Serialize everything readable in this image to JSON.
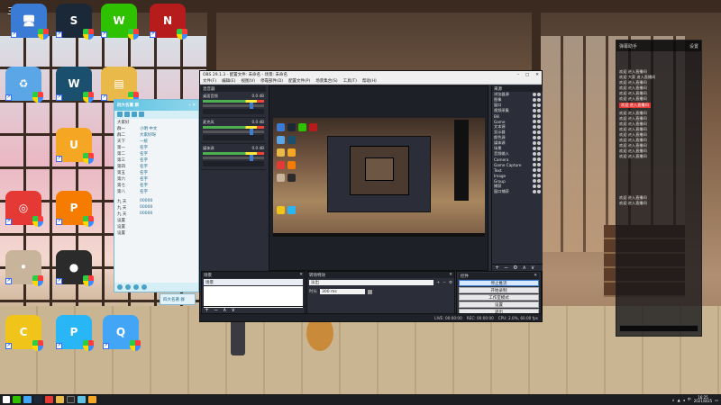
{
  "desktop": {
    "icons": [
      {
        "id": "this-pc",
        "label": "",
        "color": "#3a7bd5",
        "glyph": "🖥"
      },
      {
        "id": "steam",
        "label": "",
        "color": "#1b2838",
        "glyph": "S"
      },
      {
        "id": "wechat",
        "label": "",
        "color": "#2dc100",
        "glyph": "W"
      },
      {
        "id": "naraka",
        "label": "",
        "color": "#b71c1c",
        "glyph": "N"
      },
      {
        "id": "recycle-bin",
        "label": "",
        "color": "#5ba6e6",
        "glyph": "♻"
      },
      {
        "id": "wegame",
        "label": "",
        "color": "#1a4f6e",
        "glyph": "W"
      },
      {
        "id": "folder",
        "label": "",
        "color": "#e9b949",
        "glyph": "▤"
      },
      {
        "id": "uu-booster",
        "label": "",
        "color": "#f5a623",
        "glyph": "U"
      },
      {
        "id": "chrome",
        "label": "",
        "color": "#e53935",
        "glyph": "◎"
      },
      {
        "id": "pdf-app",
        "label": "",
        "color": "#f57c00",
        "glyph": "P"
      },
      {
        "id": "bongo-cat",
        "label": "",
        "color": "#c8b49b",
        "glyph": "•"
      },
      {
        "id": "obs-studio",
        "label": "",
        "color": "#2b2b2b",
        "glyph": "●"
      },
      {
        "id": "app-yellow",
        "label": "",
        "color": "#f0c419",
        "glyph": "C"
      },
      {
        "id": "app-blue",
        "label": "",
        "color": "#29b6f6",
        "glyph": "P"
      },
      {
        "id": "qq",
        "label": "",
        "color": "#42a5f5",
        "glyph": "Q"
      }
    ],
    "top_left_text": "三国"
  },
  "qq_app": {
    "title": "四大名著 群",
    "group_label": "大家好",
    "rows": [
      {
        "k": "群一",
        "v": "小明 中文",
        "r": ""
      },
      {
        "k": "群二",
        "v": "大家好呀",
        "r": ""
      },
      {
        "k": "天下",
        "v": "一统",
        "r": ""
      },
      {
        "k": "第一",
        "v": "名字",
        "r": ""
      },
      {
        "k": "第二",
        "v": "名字",
        "r": ""
      },
      {
        "k": "第三",
        "v": "名字",
        "r": ""
      },
      {
        "k": "第四",
        "v": "名字",
        "r": ""
      },
      {
        "k": "第五",
        "v": "名字",
        "r": ""
      },
      {
        "k": "第六",
        "v": "名字",
        "r": ""
      },
      {
        "k": "第七",
        "v": "名字",
        "r": ""
      },
      {
        "k": "第八",
        "v": "名字",
        "r": ""
      }
    ],
    "rows2": [
      {
        "k": "九 天",
        "v": "00000",
        "r": ""
      },
      {
        "k": "九 天",
        "v": "00000",
        "r": ""
      },
      {
        "k": "九 天",
        "v": "00000",
        "r": ""
      },
      {
        "k": "设置",
        "v": "",
        "r": ""
      },
      {
        "k": "设置",
        "v": "",
        "r": ""
      },
      {
        "k": "设置",
        "v": "",
        "r": ""
      }
    ],
    "small_window_text": "四大名著 群"
  },
  "chat_panel": {
    "header_left": "弹幕助手",
    "header_right": "设置",
    "lines": [
      "欢迎 进入直播间",
      "欢迎 大家 进入直播间",
      "欢迎 进入直播间",
      "欢迎 进入直播间",
      "欢迎 进入直播间",
      "欢迎 进入直播间",
      "欢迎 进入直播间",
      "欢迎 进入直播间",
      "欢迎 进入直播间",
      "欢迎 进入直播间",
      "欢迎 进入直播间",
      "欢迎 进入直播间",
      "欢迎 进入直播间",
      "欢迎 进入直播间",
      "欢迎 进入直播间",
      "欢迎 进入直播间"
    ],
    "highlight_index": 6,
    "bottom_lines": [
      "欢迎 进入直播间",
      "欢迎 进入直播间"
    ],
    "input_placeholder": ""
  },
  "obs": {
    "title": "OBS 29.1.3 - 配置文件: 未命名 - 场景: 未命名",
    "menu": [
      "文件(F)",
      "编辑(E)",
      "视图(V)",
      "停靠部件(D)",
      "配置文件(P)",
      "场景集合(S)",
      "工具(T)",
      "帮助(H)"
    ],
    "mixer": {
      "header": "混音器",
      "tracks": [
        {
          "name": "桌面音频",
          "db": "0.0 dB"
        },
        {
          "name": "麦克风",
          "db": "0.0 dB"
        },
        {
          "name": "媒体源",
          "db": "0.0 dB"
        }
      ]
    },
    "sources": {
      "header": "来源",
      "items": [
        "浏览器源",
        "图像",
        "窗口",
        "视频采集",
        "Bili",
        "Game",
        "文本源",
        "显示器",
        "颜色源",
        "媒体源",
        "场景",
        "音频输入",
        "Camera",
        "Game Capture",
        "Text",
        "Image",
        "Group",
        "捕获",
        "窗口捕获"
      ]
    },
    "scenes": {
      "header": "场景",
      "selected": "场景"
    },
    "transitions": {
      "header": "转场特效",
      "type": "淡出",
      "duration_label": "时长",
      "duration": "300 ms"
    },
    "controls": {
      "header": "控件",
      "buttons": [
        "停止推流",
        "开始录制",
        "工作室模式",
        "设置",
        "退出"
      ]
    },
    "status": [
      "LIVE: 00:00:00",
      "REC: 00:00:00",
      "CPU: 2.0%, 60.00 fps"
    ]
  },
  "taskbar": {
    "time": "16:25",
    "date": "2021/8/25",
    "tray_text": "中"
  }
}
